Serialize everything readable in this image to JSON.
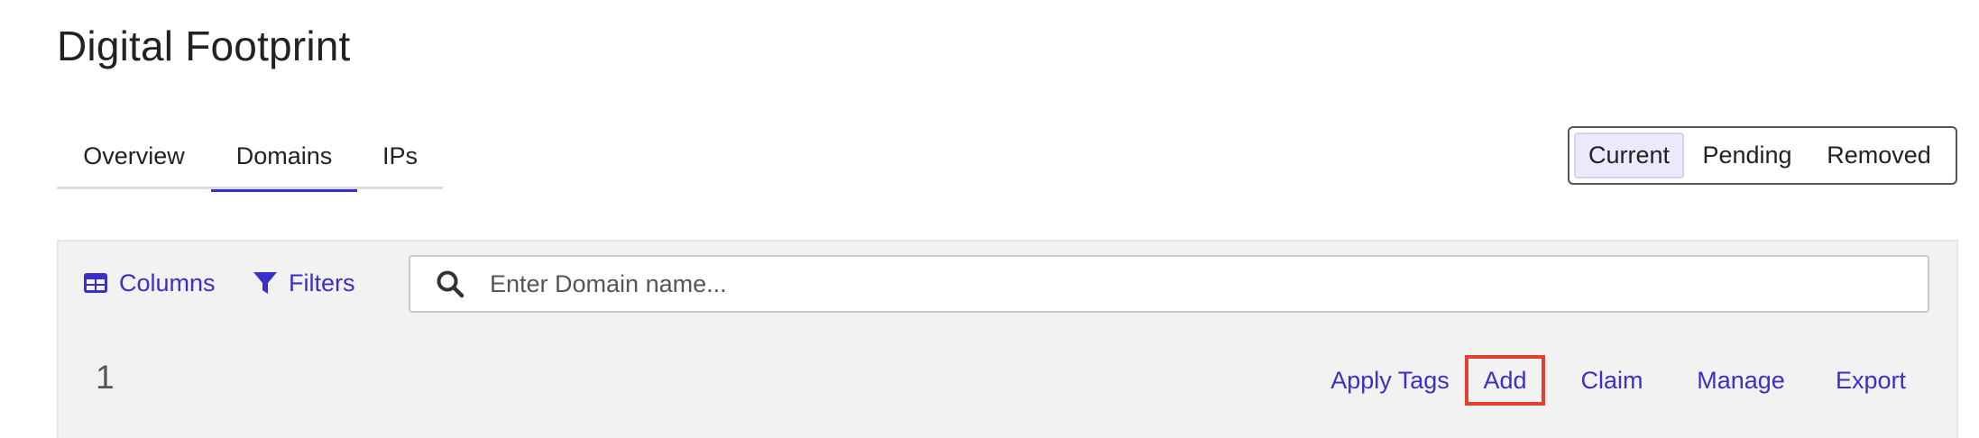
{
  "page": {
    "title": "Digital Footprint"
  },
  "tabs": [
    {
      "label": "Overview",
      "active": false
    },
    {
      "label": "Domains",
      "active": true
    },
    {
      "label": "IPs",
      "active": false
    }
  ],
  "status_toggle": {
    "options": [
      "Current",
      "Pending",
      "Removed"
    ],
    "selected": "Current"
  },
  "toolbar": {
    "columns_label": "Columns",
    "columns_icon": "table-columns-icon",
    "filters_label": "Filters",
    "filters_icon": "filter-funnel-icon",
    "search_icon": "search-icon",
    "search_placeholder": "Enter Domain name...",
    "search_value": ""
  },
  "results": {
    "count": "1",
    "actions": [
      "Apply Tags",
      "Add",
      "Claim",
      "Manage",
      "Export"
    ],
    "highlighted_action": "Add"
  },
  "colors": {
    "accent": "#3b2fc9",
    "highlight_border": "#e2412f",
    "panel_bg": "#f2f2f2",
    "active_segment_bg": "#ebe9fb"
  }
}
